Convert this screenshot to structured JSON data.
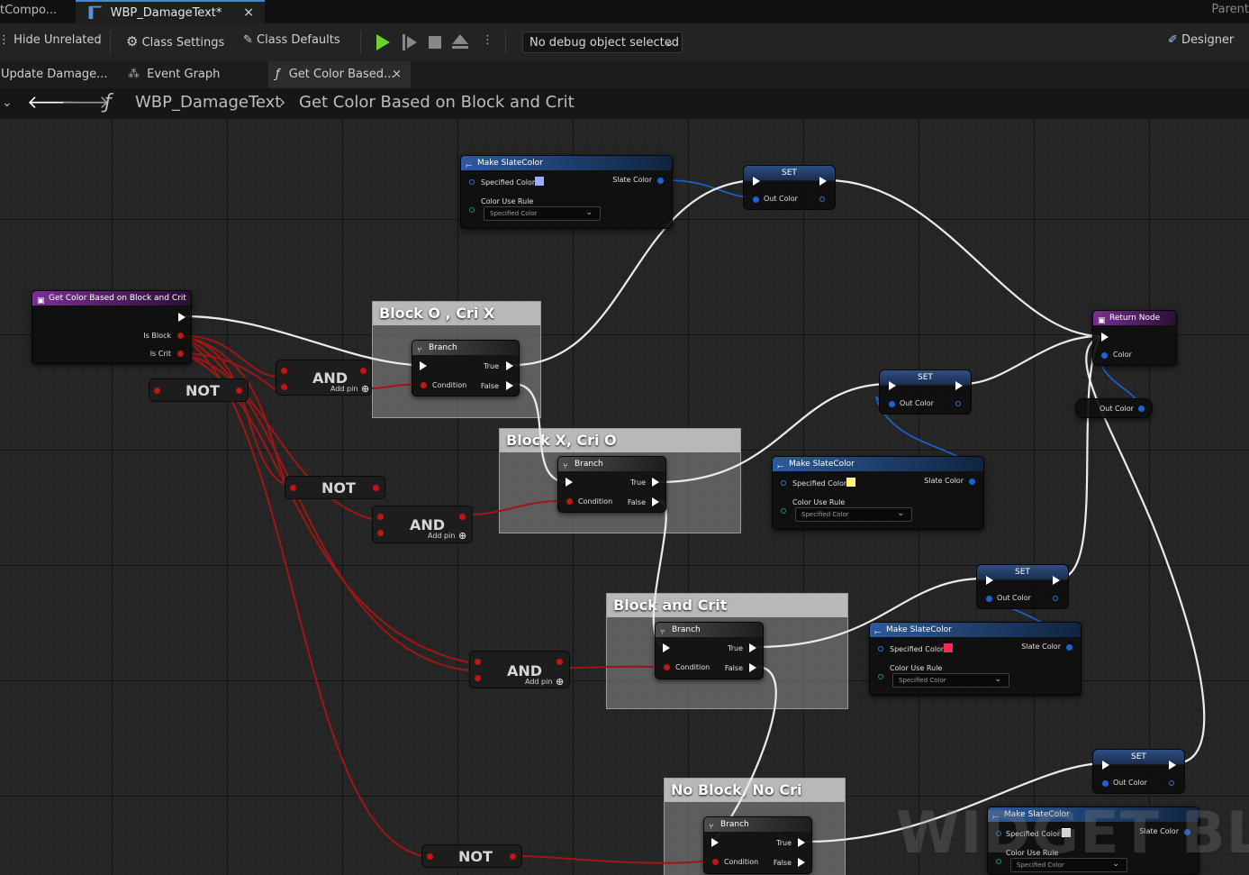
{
  "window": {
    "tabs": [
      {
        "label": "tCompo..."
      },
      {
        "label": "WBP_DamageText*"
      }
    ],
    "tab_close": "×",
    "right_label": "Parent"
  },
  "toolbar": {
    "hide_unrelated": "Hide Unrelated",
    "class_settings": "Class Settings",
    "class_defaults": "Class Defaults",
    "debug_dropdown": "No debug object selected",
    "designer": "Designer"
  },
  "document_tabs": [
    {
      "label": "Update Damage..."
    },
    {
      "label": "Event Graph"
    },
    {
      "label": "Get Color Based..."
    }
  ],
  "breadcrumb": {
    "blueprint": "WBP_DamageText",
    "separator": "›",
    "function": "Get Color Based on Block and Crit"
  },
  "comments": [
    {
      "title": "Block O , Cri X"
    },
    {
      "title": "Block X, Cri O"
    },
    {
      "title": "Block and Crit"
    },
    {
      "title": "No Block, No Cri"
    }
  ],
  "entry_node": {
    "title": "Get Color Based on Block and Crit",
    "pin_block": "Is Block",
    "pin_crit": "Is Crit"
  },
  "branch": {
    "title": "Branch",
    "true": "True",
    "false": "False",
    "condition": "Condition"
  },
  "make_slate_color": {
    "title": "Make SlateColor",
    "specified_color": "Specified Color",
    "slate_color": "Slate Color",
    "color_use_rule": "Color Use Rule",
    "rule_value": "Specified Color",
    "swatches": [
      "#a0a8ff",
      "#fff27a",
      "#ff2a55",
      "#ffffff"
    ]
  },
  "set_node": {
    "title": "SET",
    "out_color": "Out Color"
  },
  "return_node": {
    "title": "Return Node",
    "color": "Color"
  },
  "out_color_getter": "Out Color",
  "ops": {
    "and": "AND",
    "add_pin": "Add pin",
    "not": "NOT"
  },
  "watermark": "WIDGET BLUEPRINT",
  "colors": {
    "exec": "#ffffff",
    "bool": "#a01515",
    "struct": "#1a64d8",
    "accent": "#3a8be0"
  }
}
